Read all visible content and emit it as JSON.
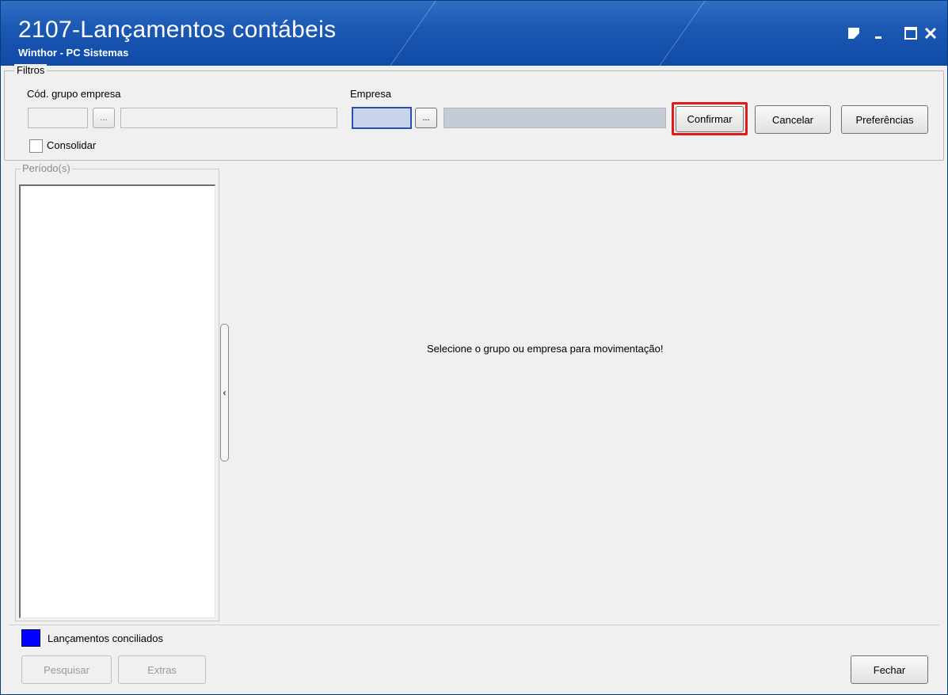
{
  "window": {
    "title": "2107-Lançamentos contábeis",
    "subtitle": "Winthor - PC Sistemas",
    "controls": [
      "restore-icon",
      "minimize-icon",
      "maximize-icon",
      "close-icon"
    ]
  },
  "filtros": {
    "legend": "Filtros",
    "grupo_label": "Cód. grupo empresa",
    "empresa_label": "Empresa",
    "dots_label": "...",
    "consolidar_label": "Consolidar",
    "consolidar_checked": false
  },
  "buttons": {
    "confirmar": "Confirmar",
    "cancelar": "Cancelar",
    "preferencias": "Preferências",
    "pesquisar": "Pesquisar",
    "extras": "Extras",
    "fechar": "Fechar"
  },
  "periodo": {
    "legend": "Período(s)"
  },
  "main": {
    "message": "Selecione o grupo ou empresa para movimentação!"
  },
  "footer": {
    "legend_label": "Lançamentos conciliados",
    "legend_color": "#0000ff"
  },
  "colors": {
    "titlebar": "#1c59b3",
    "highlight": "#e01b1b"
  }
}
